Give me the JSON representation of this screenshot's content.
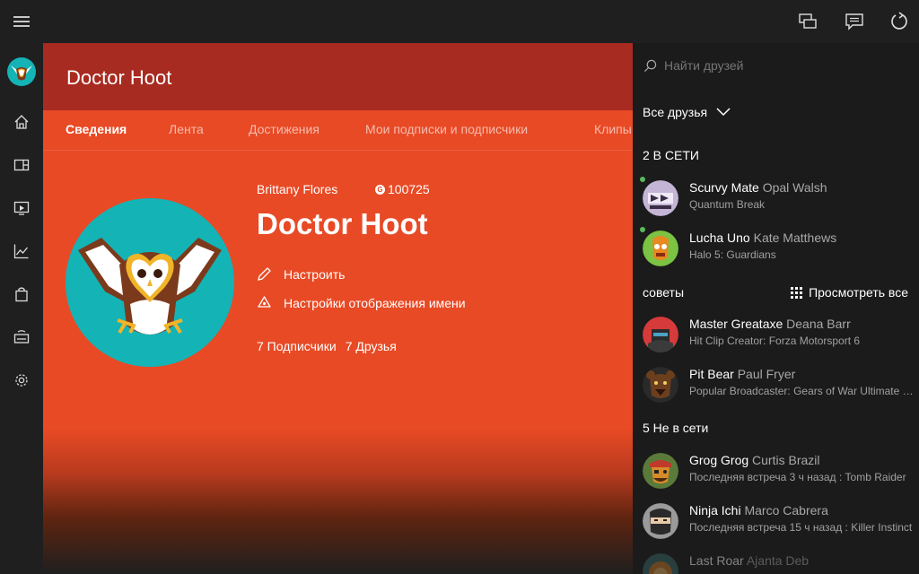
{
  "profile": {
    "title": "Doctor Hoot",
    "real_name": "Brittany Flores",
    "gamerscore": "100725",
    "gamertag": "Doctor Hoot",
    "actions": [
      "Настроить",
      "Настройки отображения имени"
    ],
    "followers": "7 Подписчики",
    "friends": "7 Друзья",
    "tabs": [
      {
        "label": "Сведения",
        "active": true
      },
      {
        "label": "Лента",
        "active": false
      },
      {
        "label": "Достижения",
        "active": false
      },
      {
        "label": "Мои подписки и подписчики",
        "active": false
      },
      {
        "label": "Клипы",
        "active": false
      }
    ]
  },
  "friends_panel": {
    "search_placeholder": "Найти друзей",
    "filter_label": "Все друзья",
    "online_header": "2 В СЕТИ",
    "suggestions_header": "советы",
    "view_all_label": "Просмотреть все",
    "offline_header": "5 Не в сети",
    "online": [
      {
        "gamertag": "Scurvy Mate",
        "real_name": "Opal Walsh",
        "status": "Quantum Break",
        "icon": "skull-ship-avatar"
      },
      {
        "gamertag": "Lucha Uno",
        "real_name": "Kate Matthews",
        "status": "Halo 5: Guardians",
        "icon": "luchador-avatar"
      }
    ],
    "suggestions": [
      {
        "gamertag": "Master Greataxe",
        "real_name": "Deana Barr",
        "status": "Hit Clip Creator: Forza Motorsport 6",
        "icon": "warrior-avatar"
      },
      {
        "gamertag": "Pit Bear",
        "real_name": "Paul Fryer",
        "status": "Popular Broadcaster: Gears of War Ultimate Edition",
        "icon": "bear-avatar"
      }
    ],
    "offline": [
      {
        "gamertag": "Grog Grog",
        "real_name": "Curtis Brazil",
        "status": "Последняя встреча 3 ч назад : Tomb Raider",
        "icon": "pirate-avatar"
      },
      {
        "gamertag": "Ninja Ichi",
        "real_name": "Marco Cabrera",
        "status": "Последняя встреча 15 ч назад : Killer Instinct",
        "icon": "ninja-avatar"
      },
      {
        "gamertag": "Last Roar",
        "real_name": "Ajanta Deb",
        "status": "",
        "icon": "lion-avatar"
      }
    ]
  },
  "colors": {
    "accent": "#e84a25",
    "header": "#a82b21",
    "avatar_bg": "#14b3b6",
    "online": "#5cb85c"
  }
}
